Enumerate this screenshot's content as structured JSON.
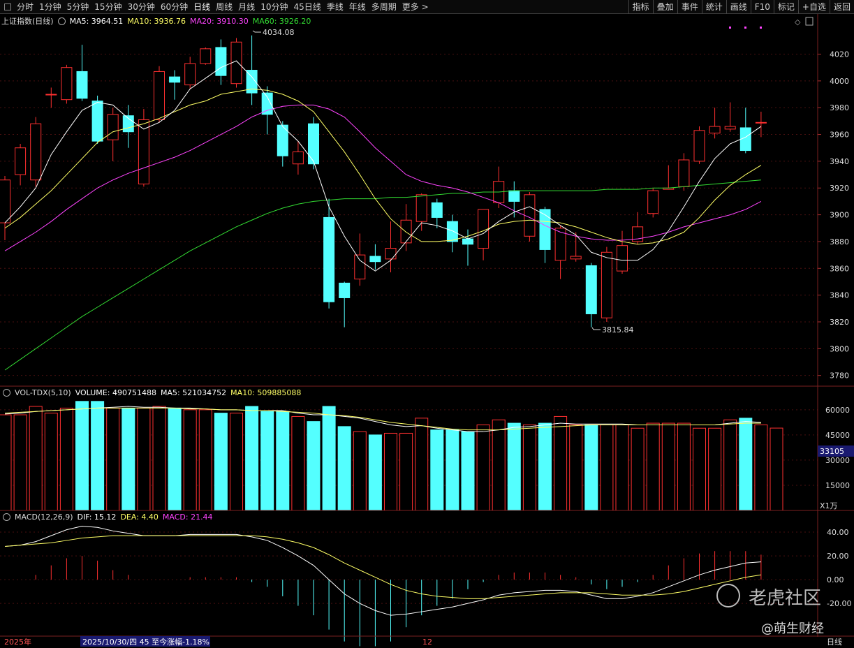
{
  "toolbar": {
    "left": [
      "分时",
      "1分钟",
      "5分钟",
      "15分钟",
      "30分钟",
      "60分钟",
      "日线",
      "周线",
      "月线",
      "10分钟",
      "45日线",
      "季线",
      "年线",
      "多周期",
      "更多 >"
    ],
    "active": "日线",
    "right": [
      "指标",
      "叠加",
      "事件",
      "统计",
      "画线",
      "F10",
      "标记",
      "+自选",
      "返回"
    ]
  },
  "main_legend": {
    "title": "上证指数(日线)",
    "ma5": "MA5: 3964.51",
    "ma10": "MA10: 3936.76",
    "ma20": "MA20: 3910.30",
    "ma60": "MA60: 3926.20"
  },
  "vol_legend": {
    "title": "VOL-TDX(5,10)",
    "volume": "VOLUME: 490751488",
    "ma5": "MA5: 521034752",
    "ma10": "MA10: 509885088"
  },
  "macd_legend": {
    "title": "MACD(12,26,9)",
    "dif": "DIF: 15.12",
    "dea": "DEA: 4.40",
    "macd": "MACD: 21.44"
  },
  "price_axis": [
    "4020",
    "4000",
    "3980",
    "3960",
    "3940",
    "3920",
    "3900",
    "3880",
    "3860",
    "3840",
    "3820",
    "3800",
    "3780"
  ],
  "vol_axis": [
    "60000",
    "45000",
    "30000",
    "15000"
  ],
  "vol_unit": "X1万",
  "vol_current": "33105",
  "macd_axis": [
    "40.00",
    "20.00",
    "0.00",
    "-20.00"
  ],
  "annotations": {
    "high": "4034.08",
    "low": "3815.84"
  },
  "bottom": {
    "year": "2025年",
    "info": "2025/10/30/四 45 至今涨幅-1.18%",
    "month": "12",
    "period": "日线"
  },
  "watermark": {
    "brand": "老虎社区",
    "author": "@萌生财经"
  },
  "colors": {
    "up": "#ff3030",
    "down": "#54ffff",
    "ma5": "#ffffff",
    "ma10": "#ffff66",
    "ma20": "#ff44ff",
    "ma60": "#33dd33"
  },
  "chart_data": {
    "type": "candlestick",
    "price_range": [
      3772,
      4050
    ],
    "candles": [
      [
        3894,
        3926,
        3929,
        3881
      ],
      [
        3930,
        3950,
        3953,
        3922
      ],
      [
        3926,
        3968,
        3973,
        3921
      ],
      [
        3990,
        3990,
        3995,
        3980
      ],
      [
        3986,
        4010,
        4012,
        3983
      ],
      [
        4007,
        3987,
        4027,
        3985
      ],
      [
        3985,
        3955,
        3989,
        3953
      ],
      [
        3956,
        3975,
        3980,
        3940
      ],
      [
        3974,
        3962,
        3982,
        3950
      ],
      [
        3923,
        3971,
        3979,
        3921
      ],
      [
        3971,
        4007,
        4011,
        3969
      ],
      [
        4003,
        3999,
        4008,
        3986
      ],
      [
        3997,
        4013,
        4018,
        3994
      ],
      [
        4013,
        4024,
        4025,
        4012
      ],
      [
        4025,
        4004,
        4031,
        3997
      ],
      [
        3998,
        4029,
        4032,
        3995
      ],
      [
        4008,
        3991,
        4034,
        3982
      ],
      [
        3991,
        3975,
        3996,
        3960
      ],
      [
        3967,
        3944,
        3970,
        3936
      ],
      [
        3938,
        3947,
        3955,
        3930
      ],
      [
        3968,
        3938,
        3973,
        3934
      ],
      [
        3898,
        3835,
        3912,
        3830
      ],
      [
        3849,
        3838,
        3850,
        3816
      ],
      [
        3852,
        3870,
        3886,
        3847
      ],
      [
        3869,
        3865,
        3878,
        3859
      ],
      [
        3867,
        3875,
        3895,
        3857
      ],
      [
        3879,
        3896,
        3908,
        3873
      ],
      [
        3895,
        3915,
        3916,
        3888
      ],
      [
        3909,
        3898,
        3912,
        3890
      ],
      [
        3895,
        3880,
        3900,
        3872
      ],
      [
        3882,
        3878,
        3889,
        3862
      ],
      [
        3875,
        3904,
        3904,
        3866
      ],
      [
        3909,
        3925,
        3936,
        3905
      ],
      [
        3918,
        3910,
        3925,
        3898
      ],
      [
        3884,
        3915,
        3917,
        3880
      ],
      [
        3904,
        3874,
        3906,
        3864
      ],
      [
        3866,
        3890,
        3892,
        3852
      ],
      [
        3867,
        3869,
        3887,
        3865
      ],
      [
        3862,
        3826,
        3864,
        3816
      ],
      [
        3823,
        3872,
        3876,
        3820
      ],
      [
        3858,
        3877,
        3888,
        3856
      ],
      [
        3880,
        3891,
        3902,
        3878
      ],
      [
        3901,
        3918,
        3920,
        3898
      ],
      [
        3919,
        3920,
        3937,
        3919
      ],
      [
        3921,
        3941,
        3946,
        3918
      ],
      [
        3940,
        3963,
        3966,
        3938
      ],
      [
        3961,
        3966,
        3980,
        3957
      ],
      [
        3964,
        3966,
        3984,
        3962
      ],
      [
        3965,
        3948,
        3980,
        3946
      ],
      [
        3969,
        3969,
        3977,
        3958
      ]
    ],
    "ma5": [
      3894,
      3906,
      3920,
      3945,
      3962,
      3978,
      3984,
      3982,
      3972,
      3964,
      3969,
      3978,
      3994,
      4002,
      4010,
      4015,
      4003,
      3988,
      3966,
      3955,
      3940,
      3906,
      3884,
      3866,
      3858,
      3866,
      3880,
      3894,
      3892,
      3888,
      3882,
      3886,
      3895,
      3902,
      3906,
      3900,
      3892,
      3885,
      3872,
      3868,
      3866,
      3866,
      3874,
      3888,
      3906,
      3925,
      3942,
      3953,
      3958,
      3966
    ],
    "ma10": [
      3890,
      3898,
      3908,
      3918,
      3930,
      3942,
      3954,
      3962,
      3965,
      3968,
      3972,
      3977,
      3982,
      3985,
      3990,
      3992,
      3994,
      3993,
      3990,
      3985,
      3977,
      3962,
      3947,
      3930,
      3912,
      3897,
      3887,
      3880,
      3880,
      3881,
      3884,
      3888,
      3893,
      3895,
      3896,
      3895,
      3894,
      3891,
      3887,
      3883,
      3880,
      3878,
      3879,
      3882,
      3887,
      3898,
      3911,
      3922,
      3930,
      3937
    ],
    "ma20": [
      3873,
      3880,
      3887,
      3895,
      3904,
      3912,
      3920,
      3926,
      3931,
      3935,
      3939,
      3943,
      3948,
      3954,
      3960,
      3966,
      3973,
      3978,
      3981,
      3982,
      3982,
      3979,
      3973,
      3962,
      3950,
      3940,
      3930,
      3925,
      3922,
      3920,
      3917,
      3913,
      3909,
      3903,
      3898,
      3892,
      3887,
      3884,
      3882,
      3881,
      3881,
      3882,
      3884,
      3887,
      3891,
      3894,
      3897,
      3900,
      3904,
      3910
    ],
    "ma60": [
      3784,
      3792,
      3800,
      3808,
      3816,
      3824,
      3831,
      3838,
      3845,
      3852,
      3859,
      3866,
      3873,
      3879,
      3885,
      3891,
      3896,
      3901,
      3905,
      3908,
      3910,
      3911,
      3912,
      3912,
      3912,
      3913,
      3913,
      3914,
      3915,
      3916,
      3916,
      3917,
      3917,
      3918,
      3918,
      3918,
      3918,
      3918,
      3918,
      3919,
      3919,
      3919,
      3920,
      3920,
      3921,
      3922,
      3923,
      3924,
      3925,
      3926
    ],
    "vol_range": [
      0,
      67000
    ],
    "volume": [
      57000,
      57000,
      62000,
      58000,
      61000,
      65000,
      65000,
      61000,
      61000,
      61000,
      62000,
      61000,
      60000,
      60000,
      58000,
      58000,
      62000,
      59000,
      59000,
      56000,
      53000,
      62000,
      50000,
      47000,
      45000,
      46000,
      46000,
      55000,
      48000,
      48000,
      47000,
      51000,
      54000,
      52000,
      51000,
      52000,
      56000,
      51000,
      51000,
      51000,
      51000,
      49000,
      52000,
      52000,
      52000,
      49000,
      49000,
      54000,
      55000,
      51000,
      49075
    ],
    "vol_ma5": [
      57500,
      58000,
      59000,
      59500,
      60000,
      60500,
      61000,
      61500,
      62000,
      61500,
      61500,
      61000,
      61000,
      60500,
      60000,
      60000,
      59500,
      59500,
      59500,
      58000,
      57000,
      57000,
      56000,
      55000,
      53000,
      51000,
      50000,
      50500,
      49000,
      48000,
      47000,
      47000,
      48000,
      49500,
      50000,
      51000,
      52000,
      51500,
      51500,
      51500,
      51500,
      51000,
      51000,
      51000,
      51000,
      51000,
      51000,
      52000,
      53000,
      52500
    ],
    "vol_ma10": [
      58000,
      58500,
      59000,
      59500,
      60000,
      60500,
      61000,
      61000,
      61000,
      61000,
      61000,
      61000,
      60500,
      60500,
      60000,
      60000,
      59500,
      59500,
      59000,
      58500,
      58000,
      57000,
      56500,
      55500,
      54000,
      52500,
      51500,
      50500,
      49500,
      48500,
      48000,
      48000,
      48000,
      48500,
      49000,
      49500,
      50000,
      50500,
      51000,
      51000,
      51000,
      51000,
      51000,
      51000,
      51000,
      51000,
      51000,
      51500,
      52000,
      52000
    ],
    "macd_range": [
      -44,
      50
    ],
    "dif": [
      28,
      29,
      32,
      37,
      42,
      45,
      44,
      41,
      39,
      37,
      37,
      37,
      38,
      38,
      38,
      38,
      36,
      33,
      27,
      20,
      12,
      0,
      -12,
      -20,
      -26,
      -30,
      -29,
      -27,
      -25,
      -23,
      -20,
      -17,
      -13,
      -11,
      -10,
      -9,
      -9,
      -10,
      -13,
      -16,
      -16,
      -14,
      -11,
      -6,
      -1,
      4,
      8,
      11,
      14,
      15
    ],
    "dea": [
      28,
      29,
      30,
      31,
      33,
      35,
      36,
      37,
      37,
      37,
      37,
      37,
      37,
      37,
      37,
      37,
      37,
      36,
      34,
      31,
      27,
      21,
      14,
      8,
      2,
      -4,
      -9,
      -12,
      -14,
      -15,
      -16,
      -16,
      -15,
      -14,
      -13,
      -12,
      -11,
      -11,
      -11,
      -12,
      -13,
      -13,
      -13,
      -12,
      -10,
      -7,
      -4,
      -1,
      2,
      4
    ],
    "macd": [
      0,
      0,
      4,
      12,
      18,
      20,
      16,
      8,
      4,
      0,
      0,
      0,
      2,
      2,
      2,
      2,
      -2,
      -6,
      -14,
      -22,
      -30,
      -42,
      -52,
      -56,
      -56,
      -52,
      -40,
      -30,
      -22,
      -16,
      -8,
      -2,
      4,
      6,
      6,
      6,
      4,
      2,
      -4,
      -8,
      -6,
      -2,
      4,
      12,
      18,
      22,
      24,
      24,
      24,
      21
    ]
  }
}
